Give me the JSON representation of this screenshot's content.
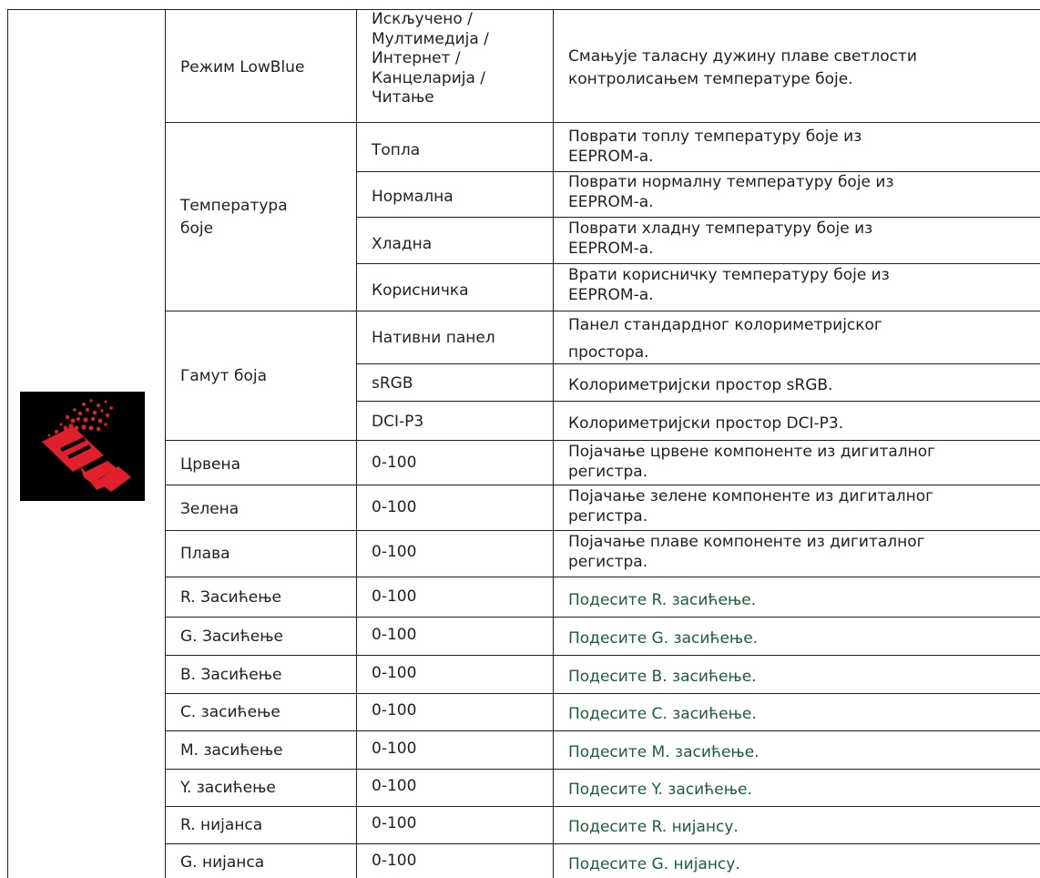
{
  "rows": [
    {
      "name": "Режим LowBlue",
      "options": [
        "Искључено /",
        "Мултимедија /",
        "Интернет /",
        "Канцеларија /",
        "Читање"
      ],
      "description": [
        "Смањује таласну дужину плаве светлости",
        "контролисањем температуре боје."
      ]
    },
    {
      "name_lines": [
        "Температура",
        "боје"
      ],
      "sub": [
        {
          "value": "Топла",
          "description": [
            "Поврати топлу температуру боје из",
            "EEPROM-а."
          ]
        },
        {
          "value": "Нормална",
          "description": [
            "Поврати нормалну температуру боје из",
            "EEPROM-а."
          ]
        },
        {
          "value": "Хладна",
          "description": [
            "Поврати хладну температуру боје из",
            "EEPROM-а."
          ]
        },
        {
          "value": "Корисничка",
          "description": [
            "Врати корисничку температуру боје из",
            "EEPROM-а."
          ]
        }
      ]
    },
    {
      "name": "Гамут боја",
      "sub": [
        {
          "value": "Нативни панел",
          "description": [
            "Панел стандардног колориметријског",
            "простора."
          ]
        },
        {
          "value": "sRGB",
          "description": [
            "Колориметријски простор sRGB."
          ]
        },
        {
          "value": "DCI-P3",
          "description": [
            "Колориметријски простор DCI-P3."
          ]
        }
      ]
    },
    {
      "name": "Црвена",
      "value": "0-100",
      "description": [
        "Појачање црвене компоненте из дигиталног",
        "регистра."
      ]
    },
    {
      "name": "Зелена",
      "value": "0-100",
      "description": [
        "Појачање зелене компоненте из дигиталног",
        "регистра."
      ]
    },
    {
      "name": "Плава",
      "value": "0-100",
      "description": [
        "Појачање плаве компоненте из дигиталног",
        "регистра."
      ]
    },
    {
      "name": "R. Засићење",
      "value": "0-100",
      "description": "Подесите R. засићење."
    },
    {
      "name": "G. Засићење",
      "value": "0-100",
      "description": "Подесите G. засићење."
    },
    {
      "name": "B. Засићење",
      "value": "0-100",
      "description": "Подесите B. засићење."
    },
    {
      "name": "C. засићење",
      "value": "0-100",
      "description": "Подесите C. засићење."
    },
    {
      "name": "M. засићење",
      "value": "0-100",
      "description": "Подесите M. засићење."
    },
    {
      "name": "Y. засићење",
      "value": "0-100",
      "description": "Подесите Y. засићење."
    },
    {
      "name": "R. нијанса",
      "value": "0-100",
      "description": "Подесите R. нијансу."
    },
    {
      "name": "G. нијанса",
      "value": "0-100",
      "description": "Подесите G. нијансу."
    }
  ],
  "icon": "paint-roller-icon",
  "colors": {
    "icon_background": "#000000",
    "icon_accent": "#e0202b",
    "border": "#231f20",
    "description_text": "#1b5e3a"
  }
}
